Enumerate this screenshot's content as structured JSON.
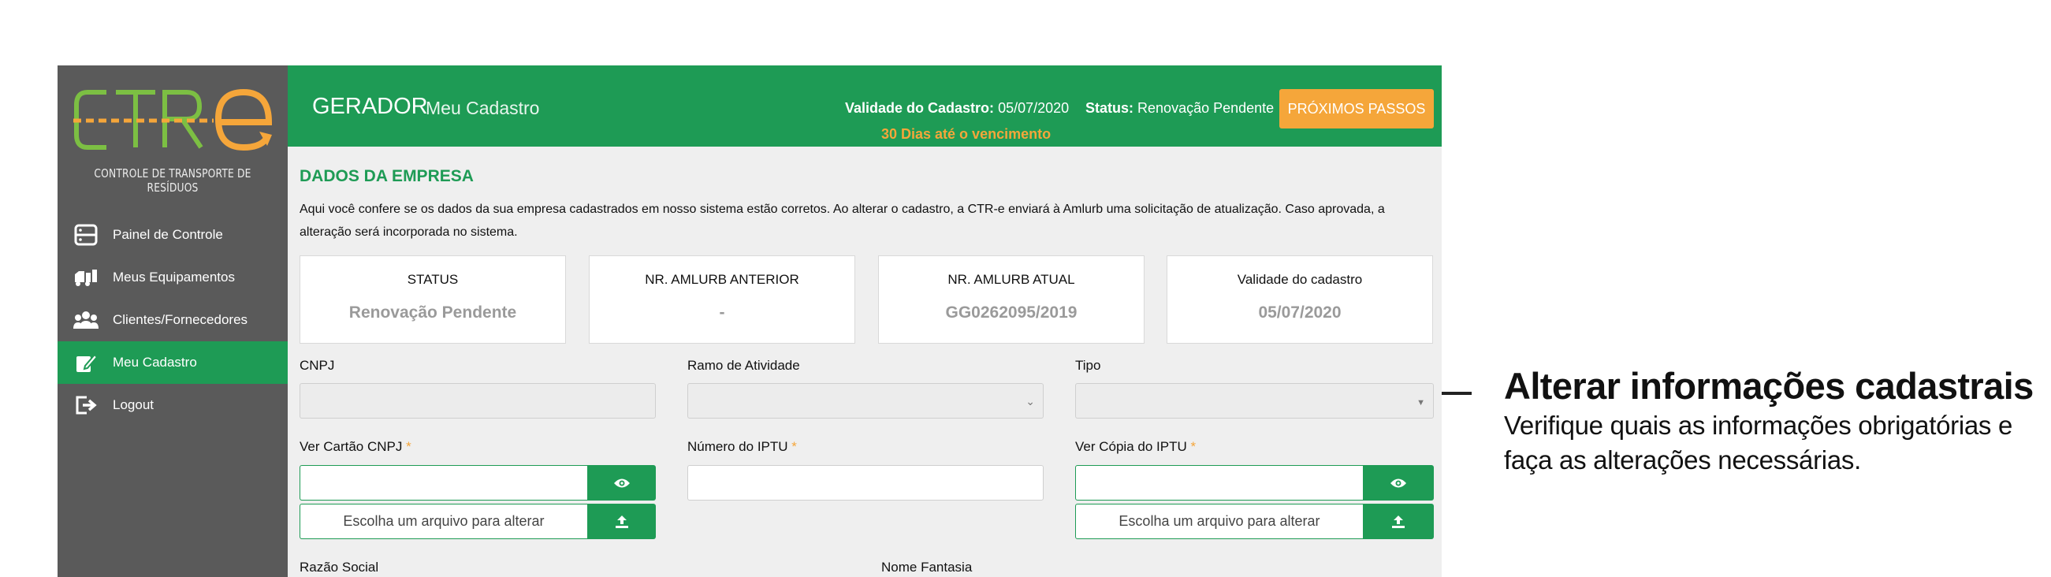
{
  "logo": {
    "text": "CTR-e",
    "subtitle": "CONTROLE DE TRANSPORTE DE RESÍDUOS"
  },
  "sidebar": {
    "items": [
      {
        "label": "Painel de Controle",
        "icon": "dashboard-icon"
      },
      {
        "label": "Meus Equipamentos",
        "icon": "truck-icon"
      },
      {
        "label": "Clientes/Fornecedores",
        "icon": "users-icon"
      },
      {
        "label": "Meu Cadastro",
        "icon": "edit-icon",
        "active": true
      },
      {
        "label": "Logout",
        "icon": "logout-icon"
      }
    ]
  },
  "header": {
    "title": "GERADOR",
    "subtitle": "Meu Cadastro",
    "validity_label": "Validade do Cadastro:",
    "validity_value": "05/07/2020",
    "status_label": "Status:",
    "status_value": "Renovação Pendente",
    "days_text": "30 Dias até o vencimento",
    "next_steps_button": "PRÓXIMOS PASSOS"
  },
  "section": {
    "title": "DADOS DA EMPRESA",
    "description": "Aqui você confere se os dados da sua empresa cadastrados em nosso sistema estão corretos. Ao alterar o cadastro, a CTR-e enviará à Amlurb uma solicitação de atualização. Caso aprovada, a alteração será incorporada no sistema."
  },
  "cards": [
    {
      "label": "STATUS",
      "value": "Renovação Pendente"
    },
    {
      "label": "NR. AMLURB ANTERIOR",
      "value": "-"
    },
    {
      "label": "NR. AMLURB ATUAL",
      "value": "GG0262095/2019"
    },
    {
      "label": "Validade do cadastro",
      "value": "05/07/2020"
    }
  ],
  "form": {
    "cnpj_label": "CNPJ",
    "ramo_label": "Ramo de Atividade",
    "tipo_label": "Tipo",
    "cartao_cnpj_label": "Ver Cartão CNPJ",
    "iptu_number_label": "Número do IPTU",
    "iptu_copy_label": "Ver Cópia do IPTU",
    "required_mark": "*",
    "choose_file_label": "Escolha um arquivo para alterar",
    "razao_label": "Razão Social",
    "fantasia_label": "Nome Fantasia"
  },
  "annotation": {
    "title": "Alterar informações cadastrais",
    "text": "Verifique quais as informações obrigatórias e faça as alterações necessárias."
  },
  "colors": {
    "primary_green": "#1e9b55",
    "accent_orange": "#f5a63a",
    "sidebar_gray": "#5a5a5a"
  }
}
